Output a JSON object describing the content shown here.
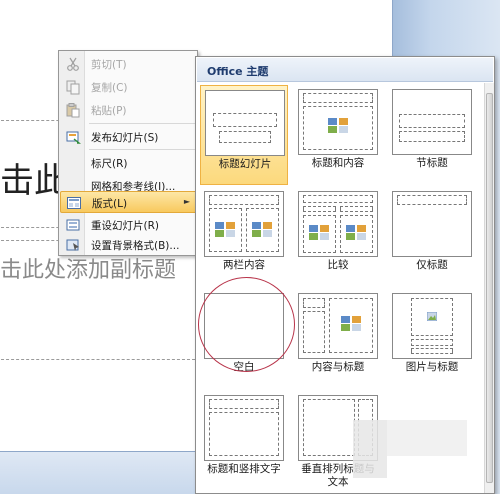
{
  "slide": {
    "title_text": "击此",
    "subtitle_text": "击此处添加副标题"
  },
  "context_menu": {
    "items": [
      {
        "label": "剪切(T)",
        "icon": "cut-icon",
        "enabled": false
      },
      {
        "label": "复制(C)",
        "icon": "copy-icon",
        "enabled": false
      },
      {
        "label": "粘贴(P)",
        "icon": "paste-icon",
        "enabled": false
      },
      {
        "label": "发布幻灯片(S)",
        "icon": "publish-slides-icon",
        "enabled": true
      },
      {
        "label": "标尺(R)",
        "icon": "",
        "enabled": true
      },
      {
        "label": "网格和参考线(I)...",
        "icon": "",
        "enabled": true
      },
      {
        "label": "版式(L)",
        "icon": "layout-icon",
        "enabled": true,
        "highlighted": true,
        "submenu_arrow": "►"
      },
      {
        "label": "重设幻灯片(R)",
        "icon": "reset-slide-icon",
        "enabled": true
      },
      {
        "label": "设置背景格式(B)...",
        "icon": "format-background-icon",
        "enabled": true
      }
    ]
  },
  "layout_gallery": {
    "header": "Office 主题",
    "selected": "标题幻灯片",
    "layouts": [
      "标题幻灯片",
      "标题和内容",
      "节标题",
      "两栏内容",
      "比较",
      "仅标题",
      "空白",
      "内容与标题",
      "图片与标题",
      "标题和竖排文字",
      "垂直排列标题与文本"
    ]
  },
  "colors": {
    "highlight": "#f8c95e",
    "annotation_circle": "#b8344a",
    "gallery_header_text": "#1e3b6e"
  }
}
